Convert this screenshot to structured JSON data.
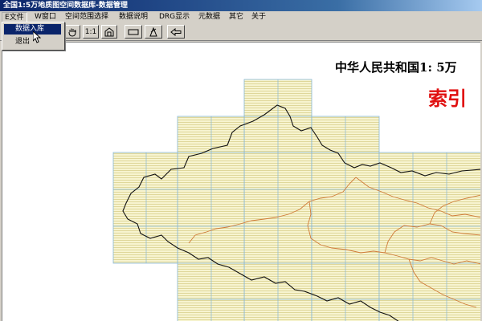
{
  "window": {
    "title": "全国1:5万地质图空间数据库-数据管理"
  },
  "menubar": {
    "items": [
      {
        "label": "E文件"
      },
      {
        "label": "W窗口"
      },
      {
        "label": "空间范围选择"
      },
      {
        "label": "数据说明"
      },
      {
        "label": "DRG显示"
      },
      {
        "label": "元数据"
      },
      {
        "label": "其它"
      },
      {
        "label": "关于"
      }
    ]
  },
  "file_menu": {
    "items": [
      {
        "label": "数据入库"
      },
      {
        "label": "退出"
      }
    ]
  },
  "toolbar": {
    "zoom_label": "1:1",
    "icons": [
      "zoom-out-icon",
      "pan-hand-icon",
      "zoom-reset-icon",
      "full-extent-icon",
      "rectangle-select-icon",
      "polygon-select-icon",
      "back-arrow-icon"
    ]
  },
  "map": {
    "title": "中华人民共和国1: 5万",
    "subtitle": "索引",
    "grid_color": "#87b8d8",
    "fill_color": "#f5f2c8",
    "border_color": "#000000",
    "province_color": "#d07030"
  }
}
